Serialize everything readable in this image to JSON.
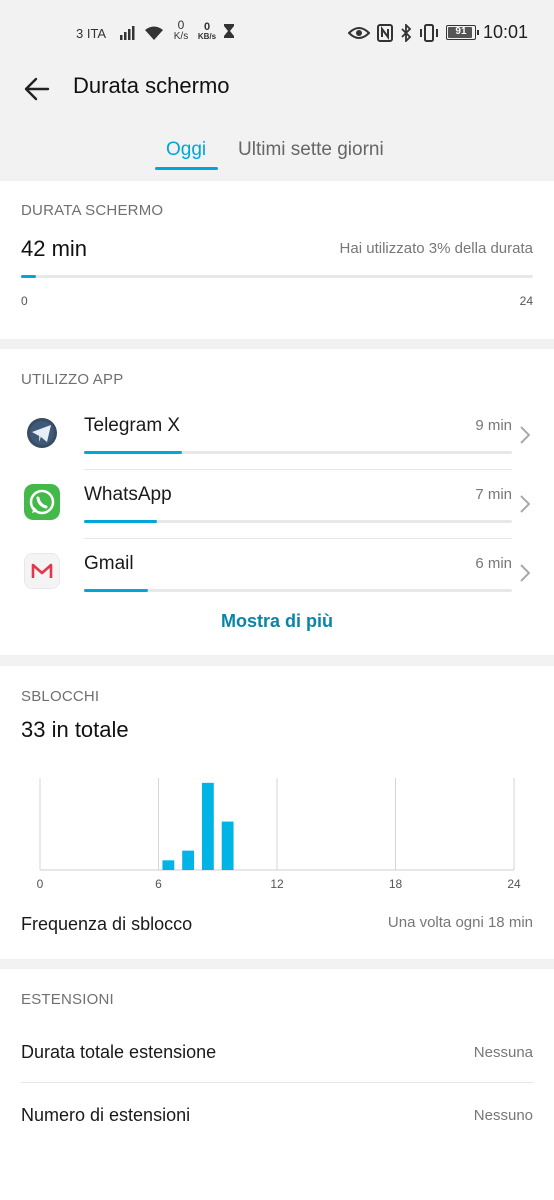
{
  "status_bar": {
    "carrier": "3 ITA",
    "net_speed_value": "0",
    "net_speed_unit": "K/s",
    "kbs_value": "0",
    "kbs_unit": "KB/s",
    "battery": "91",
    "time": "10:01"
  },
  "header": {
    "title": "Durata schermo"
  },
  "tabs": [
    {
      "label": "Oggi",
      "active": true
    },
    {
      "label": "Ultimi sette giorni",
      "active": false
    }
  ],
  "screen_time": {
    "heading": "DURATA SCHERMO",
    "total": "42 min",
    "usage_text": "Hai utilizzato 3% della durata",
    "progress_fraction": 0.03,
    "axis_min": "0",
    "axis_max": "24"
  },
  "app_usage": {
    "heading": "UTILIZZO APP",
    "items": [
      {
        "name": "Telegram X",
        "time": "9 min",
        "fraction": 0.23,
        "icon": "telegram-icon"
      },
      {
        "name": "WhatsApp",
        "time": "7 min",
        "fraction": 0.17,
        "icon": "whatsapp-icon"
      },
      {
        "name": "Gmail",
        "time": "6 min",
        "fraction": 0.15,
        "icon": "gmail-icon"
      }
    ],
    "show_more": "Mostra di più"
  },
  "unlocks": {
    "heading": "SBLOCCHI",
    "total": "33 in totale",
    "frequency_label": "Frequenza di sblocco",
    "frequency_value": "Una volta ogni 18 min"
  },
  "chart_data": {
    "type": "bar",
    "x": [
      7,
      8,
      9,
      10
    ],
    "values": [
      2,
      4,
      18,
      10
    ],
    "xlim": [
      0,
      24
    ],
    "xticks": [
      "0",
      "6",
      "12",
      "18",
      "24"
    ],
    "ylim": [
      0,
      19
    ],
    "color": "#00b4e6",
    "grid": true
  },
  "extensions": {
    "heading": "ESTENSIONI",
    "rows": [
      {
        "label": "Durata totale estensione",
        "value": "Nessuna"
      },
      {
        "label": "Numero di estensioni",
        "value": "Nessuno"
      }
    ]
  },
  "colors": {
    "accent": "#00a6d8",
    "link": "#0a84a8"
  }
}
